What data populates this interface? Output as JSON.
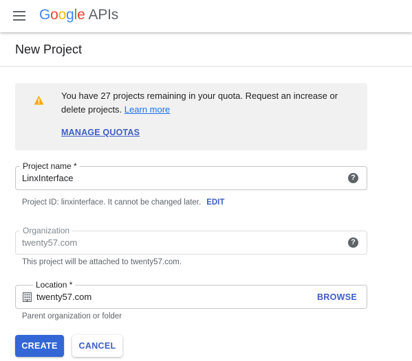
{
  "header": {
    "logo_google_letters": [
      "G",
      "o",
      "o",
      "g",
      "l",
      "e"
    ],
    "logo_suffix": "APIs"
  },
  "page": {
    "title": "New Project"
  },
  "quota_notice": {
    "message": "You have 27 projects remaining in your quota. Request an increase or delete projects.",
    "learn_more": "Learn more",
    "manage_quotas": "MANAGE QUOTAS"
  },
  "project_name": {
    "label": "Project name *",
    "value": "LinxInterface",
    "help_icon": "?"
  },
  "project_id": {
    "text": "Project ID: linxinterface. It cannot be changed later.",
    "edit_label": "EDIT"
  },
  "organization": {
    "label": "Organization",
    "value": "twenty57.com",
    "help_icon": "?",
    "helper": "This project will be attached to twenty57.com."
  },
  "location": {
    "label": "Location *",
    "value": "twenty57.com",
    "browse_label": "BROWSE",
    "helper": "Parent organization or folder"
  },
  "actions": {
    "create_label": "CREATE",
    "cancel_label": "CANCEL"
  },
  "colors": {
    "accent": "#3367d6",
    "link": "#3c5ec6",
    "warning": "#f9ab00",
    "notice_bg": "#f1f1f1"
  },
  "icons": {
    "menu": "menu-icon",
    "warning": "warning-icon",
    "help": "help-icon",
    "location": "building-icon"
  }
}
